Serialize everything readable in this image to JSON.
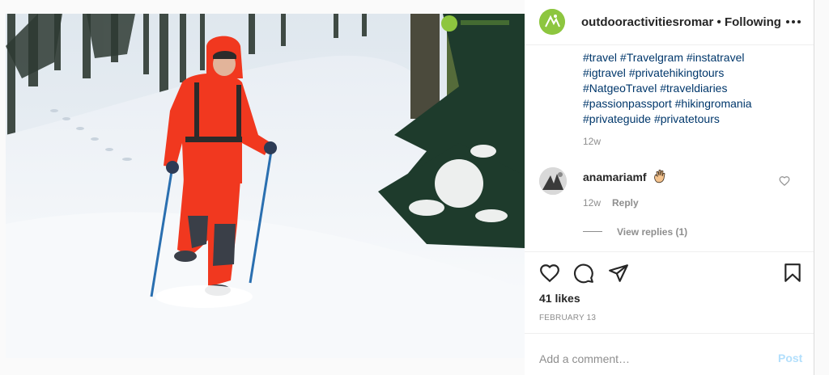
{
  "post": {
    "username": "outdooractivitiesromar",
    "separator": "•",
    "follow_label": "Following",
    "caption_tags": [
      "#travel",
      "#Travelgram",
      "#instatravel",
      "#igtravel",
      "#privatehikingtours",
      "#NatgeoTravel",
      "#traveldiaries",
      "#passionpassport",
      "#hikingromania",
      "#privateguide",
      "#privatetours"
    ],
    "caption_time": "12w",
    "likes": "41 likes",
    "date": "FEBRUARY 13"
  },
  "comment": {
    "username": "anamariamf",
    "emoji": "waving-hand",
    "time": "12w",
    "reply_label": "Reply",
    "view_replies": "View replies (1)"
  },
  "add_comment": {
    "placeholder": "Add a comment…",
    "post_label": "Post"
  },
  "icons": {
    "more": "more-options-icon",
    "like": "heart-icon",
    "comment": "comment-icon",
    "share": "share-icon",
    "save": "bookmark-icon"
  },
  "colors": {
    "brand_green": "#8dc63f",
    "link_blue": "#00376b",
    "post_disabled": "#b2dffc",
    "jacket_red": "#f1381f"
  }
}
